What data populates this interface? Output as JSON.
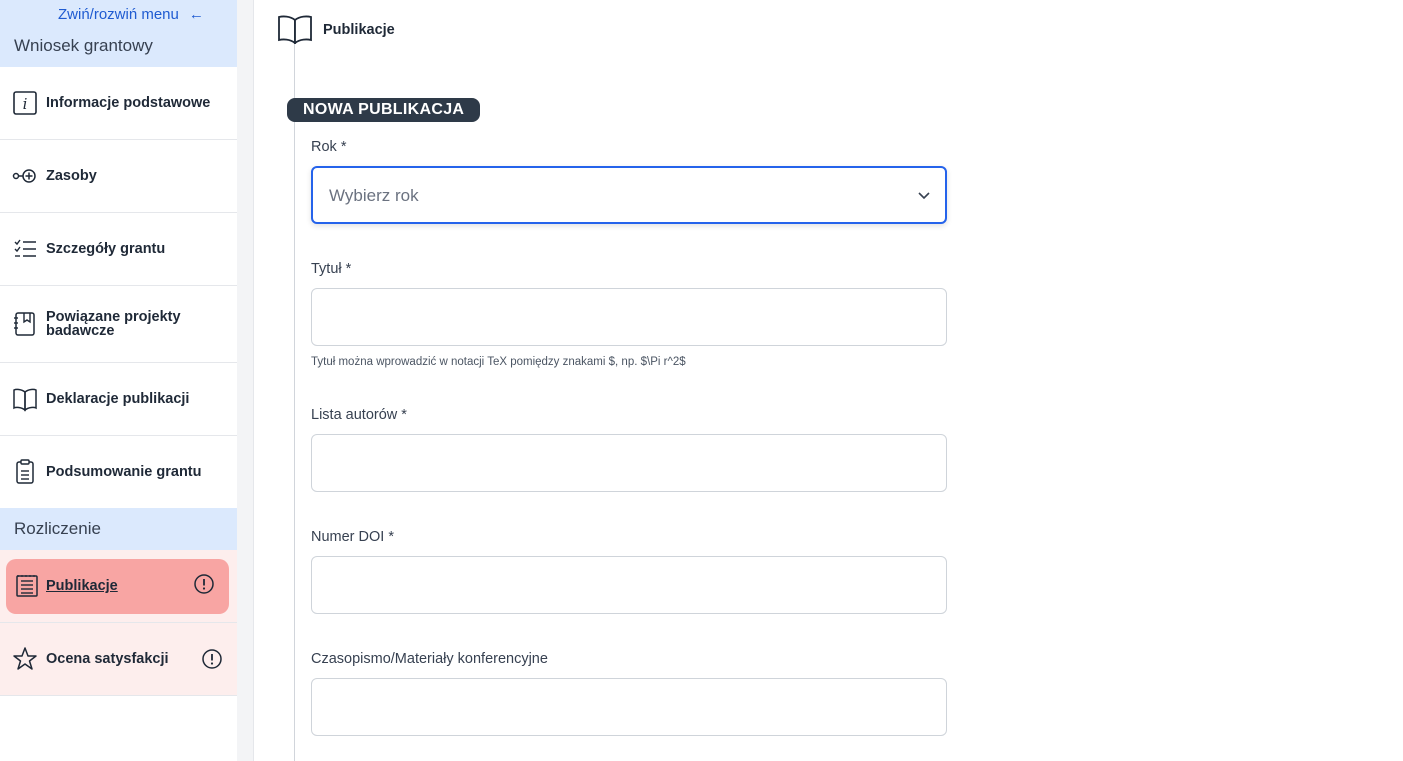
{
  "sidebar": {
    "collapse_label": "Zwiń/rozwiń menu",
    "collapse_arrow": "←",
    "section_grant": "Wniosek grantowy",
    "items": [
      {
        "label": "Informacje podstawowe",
        "icon": "info-icon"
      },
      {
        "label": "Zasoby",
        "icon": "resources-icon"
      },
      {
        "label": "Szczegóły grantu",
        "icon": "checklist-icon"
      },
      {
        "label": "Powiązane projekty badawcze",
        "icon": "notebook-icon"
      },
      {
        "label": "Deklaracje publikacji",
        "icon": "book-icon"
      },
      {
        "label": "Podsumowanie grantu",
        "icon": "clipboard-icon"
      }
    ],
    "section_settlement": "Rozliczenie",
    "settlement_items": [
      {
        "label": "Publikacje",
        "icon": "document-lines-icon",
        "status": "warning",
        "active": true
      },
      {
        "label": "Ocena satysfakcji",
        "icon": "star-icon",
        "status": "warning"
      }
    ]
  },
  "header": {
    "title": "Publikacje",
    "icon": "book-icon"
  },
  "form": {
    "badge": "NOWA PUBLIKACJA",
    "year_label": "Rok *",
    "year_placeholder": "Wybierz rok",
    "title_label": "Tytuł *",
    "title_value": "",
    "title_hint": "Tytuł można wprowadzić w notacji TeX pomiędzy znakami $, np. $\\Pi r^2$",
    "authors_label": "Lista autorów *",
    "authors_value": "",
    "doi_label": "Numer DOI *",
    "doi_value": "",
    "journal_label": "Czasopismo/Materiały konferencyjne",
    "journal_value": ""
  },
  "colors": {
    "accent_blue": "#2563eb",
    "section_bg": "#dbe9fd",
    "active_bg": "#f8a5a3",
    "warning_row_bg": "#fdeeed",
    "badge_bg": "#2e3a48"
  }
}
